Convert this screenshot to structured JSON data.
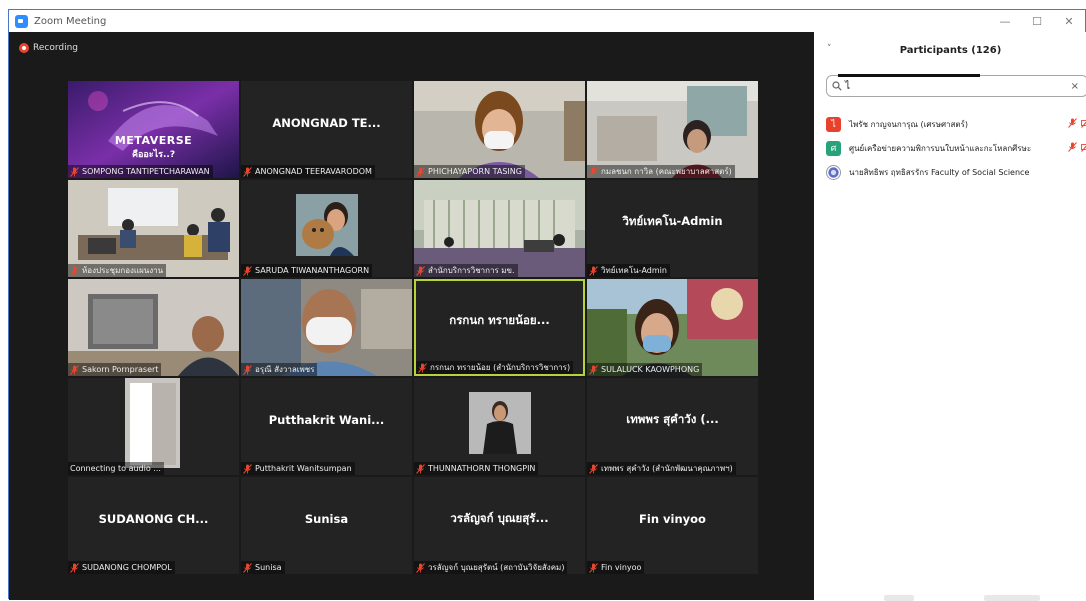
{
  "window": {
    "title": "Zoom Meeting",
    "controls": [
      "—",
      "☐",
      "✕"
    ]
  },
  "recording": {
    "label": "Recording"
  },
  "tiles": [
    {
      "name": "",
      "label": "SOMPONG TANTIPETCHARAWAN",
      "kind": "metaverse",
      "slide_title": "METAVERSE",
      "slide_sub": "คืออะไร..?"
    },
    {
      "name": "ANONGNAD TE...",
      "label": "ANONGNAD TEERAVARODOM",
      "kind": "name"
    },
    {
      "name": "",
      "label": "PHICHAYAPORN TASING",
      "kind": "woman-mask"
    },
    {
      "name": "",
      "label": "กมลชนก กาวิล (คณะพยาบาลศาสตร์)",
      "kind": "office-woman"
    },
    {
      "name": "",
      "label": "ห้องประชุมกองแผนงาน",
      "kind": "meeting-room"
    },
    {
      "name": "",
      "label": "SARUDA TIWANANTHAGORN",
      "kind": "dog-photo"
    },
    {
      "name": "",
      "label": "สำนักบริการวิชาการ มข.",
      "kind": "conference-hall"
    },
    {
      "name": "วิทย์เทคโน-Admin",
      "label": "วิทย์เทคโน-Admin",
      "kind": "name"
    },
    {
      "name": "",
      "label": "Sakorn Pornprasert",
      "kind": "man-office"
    },
    {
      "name": "",
      "label": "อรุณี สังวาลเพชร",
      "kind": "man-mask"
    },
    {
      "name": "กรกนก ทรายน้อย...",
      "label": "กรกนก ทรายน้อย (สำนักบริการวิชาการ)",
      "kind": "name",
      "active": true
    },
    {
      "name": "",
      "label": "SULALUCK KAOWPHONG",
      "kind": "woman-outdoor"
    },
    {
      "name": "",
      "label": "Connecting to audio ...",
      "kind": "room-door",
      "no_mute": true
    },
    {
      "name": "Putthakrit  Wani...",
      "label": "Putthakrit Wanitsumpan",
      "kind": "name"
    },
    {
      "name": "",
      "label": "THUNNATHORN THONGPIN",
      "kind": "portrait"
    },
    {
      "name": "เทพพร สุคำวัง (...",
      "label": "เทพพร สุคำวัง (สำนักพัฒนาคุณภาพฯ)",
      "kind": "name"
    },
    {
      "name": "SUDANONG  CH...",
      "label": "SUDANONG CHOMPOL",
      "kind": "name"
    },
    {
      "name": "Sunisa",
      "label": "Sunisa",
      "kind": "name"
    },
    {
      "name": "วรลัญจก์ บุณยสุรั...",
      "label": "วรลัญจก์ บุณยสุรัตน์ (สถาบันวิจัยสังคม)",
      "kind": "name"
    },
    {
      "name": "Fin vinyoo",
      "label": "Fin vinyoo",
      "kind": "name"
    }
  ],
  "panel": {
    "title": "Participants (126)",
    "collapse_icon": "˅",
    "search": {
      "value": "ไ",
      "clear": "×"
    },
    "participants": [
      {
        "initial": "ไ",
        "name": "ไพรัช กาญจนการุณ (เศรษศาสตร์)",
        "color": "#e8412c",
        "icons": true
      },
      {
        "initial": "ศ",
        "name": "ศูนย์เครือข่ายความพิการบนใบหน้าและกะโหลกศีรษะ",
        "color": "#27a27b",
        "icons": true
      },
      {
        "initial": "",
        "name": "นายสิทธิพร ฤทธิสรรักร Faculty of Social Science",
        "color": "#5a6dc9",
        "icons": false
      }
    ]
  },
  "colors": {
    "accent": "#2d8cff",
    "mute_red": "#e8472f",
    "active_border": "#b6d33a"
  }
}
